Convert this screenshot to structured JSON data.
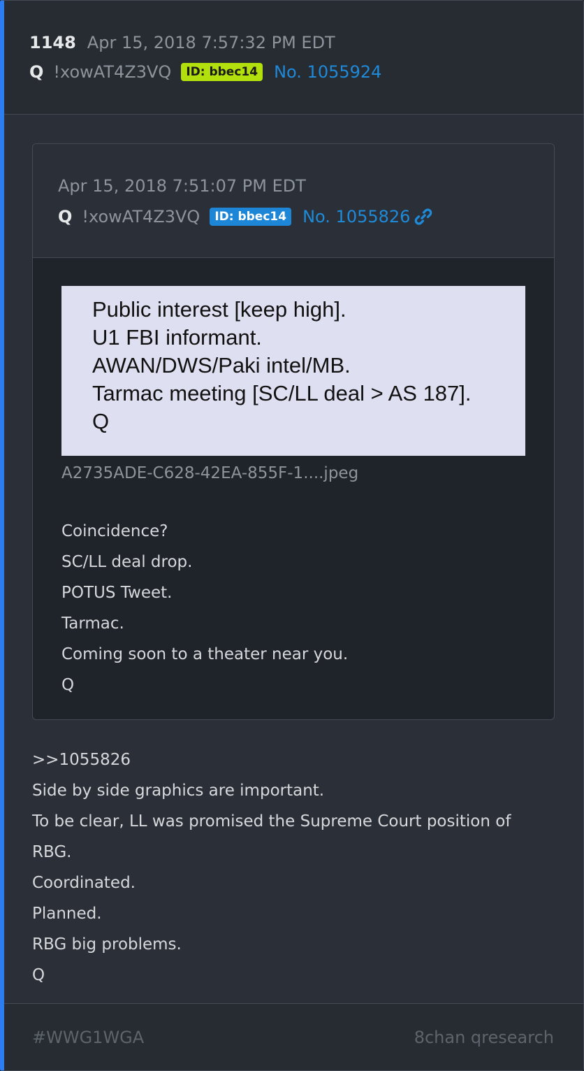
{
  "post": {
    "number": "1148",
    "date": "Apr 15, 2018 7:57:32 PM EDT",
    "author": "Q",
    "tripcode": "!xowAT4Z3VQ",
    "id_badge": "ID: bbec14",
    "post_no": "No. 1055924",
    "body": [
      ">>1055826",
      "Side by side graphics are important.",
      "To be clear, LL was promised the Supreme Court position of",
      "RBG.",
      "Coordinated.",
      "Planned.",
      "RBG big problems.",
      "Q"
    ]
  },
  "quoted": {
    "date": "Apr 15, 2018 7:51:07 PM EDT",
    "author": "Q",
    "tripcode": "!xowAT4Z3VQ",
    "id_badge": "ID: bbec14",
    "post_no": "No. 1055826",
    "link_icon": "link-icon",
    "image_text": [
      "Public interest [keep high].",
      "U1 FBI informant.",
      "AWAN/DWS/Paki intel/MB.",
      "Tarmac meeting [SC/LL deal > AS 187].",
      "Q"
    ],
    "filename": "A2735ADE-C628-42EA-855F-1....jpeg",
    "body": [
      "Coincidence?",
      "SC/LL deal drop.",
      "POTUS Tweet.",
      "Tarmac.",
      "Coming soon to a theater near you.",
      "Q"
    ]
  },
  "footer": {
    "hashtag": "#WWG1WGA",
    "source": "8chan qresearch"
  },
  "colors": {
    "accent": "#2d7cf0",
    "link": "#1f8ad8",
    "id_green": "#b2e00c",
    "id_blue": "#1e86d6"
  }
}
